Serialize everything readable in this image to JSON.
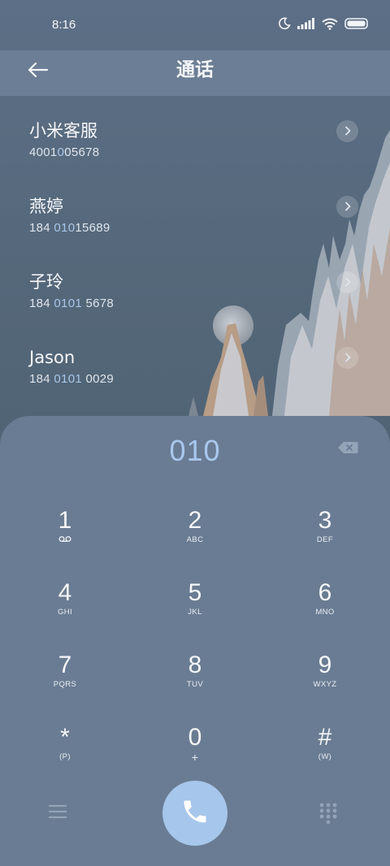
{
  "status": {
    "time": "8:16"
  },
  "header": {
    "title": "通话"
  },
  "contacts": [
    {
      "name": "小米客服",
      "num_pre": "4001",
      "num_hl": "0",
      "num_post": "05678"
    },
    {
      "name": "燕婷",
      "num_pre": "184 ",
      "num_hl": "010",
      "num_post": "15689"
    },
    {
      "name": "子玲",
      "num_pre": "184 ",
      "num_hl": "0101",
      "num_post": " 5678"
    },
    {
      "name": "Jason",
      "num_pre": "184 ",
      "num_hl": "0101",
      "num_post": " 0029"
    }
  ],
  "dialpad": {
    "input": "010",
    "keys": [
      {
        "num": "1",
        "letters": ""
      },
      {
        "num": "2",
        "letters": "ABC"
      },
      {
        "num": "3",
        "letters": "DEF"
      },
      {
        "num": "4",
        "letters": "GHI"
      },
      {
        "num": "5",
        "letters": "JKL"
      },
      {
        "num": "6",
        "letters": "MNO"
      },
      {
        "num": "7",
        "letters": "PQRS"
      },
      {
        "num": "8",
        "letters": "TUV"
      },
      {
        "num": "9",
        "letters": "WXYZ"
      },
      {
        "num": "*",
        "letters": "(P)"
      },
      {
        "num": "0",
        "letters": "+"
      },
      {
        "num": "#",
        "letters": "(W)"
      }
    ]
  },
  "colors": {
    "accent": "#a6c6eb",
    "panel": "#6a7c93",
    "appbar": "#6c7e95"
  },
  "icons": {
    "back": "arrow-left-icon",
    "chevron": "chevron-right-icon",
    "backspace": "backspace-icon",
    "voicemail": "voicemail-icon",
    "menu": "menu-icon",
    "call": "phone-icon",
    "keypad": "dialpad-grid-icon"
  }
}
